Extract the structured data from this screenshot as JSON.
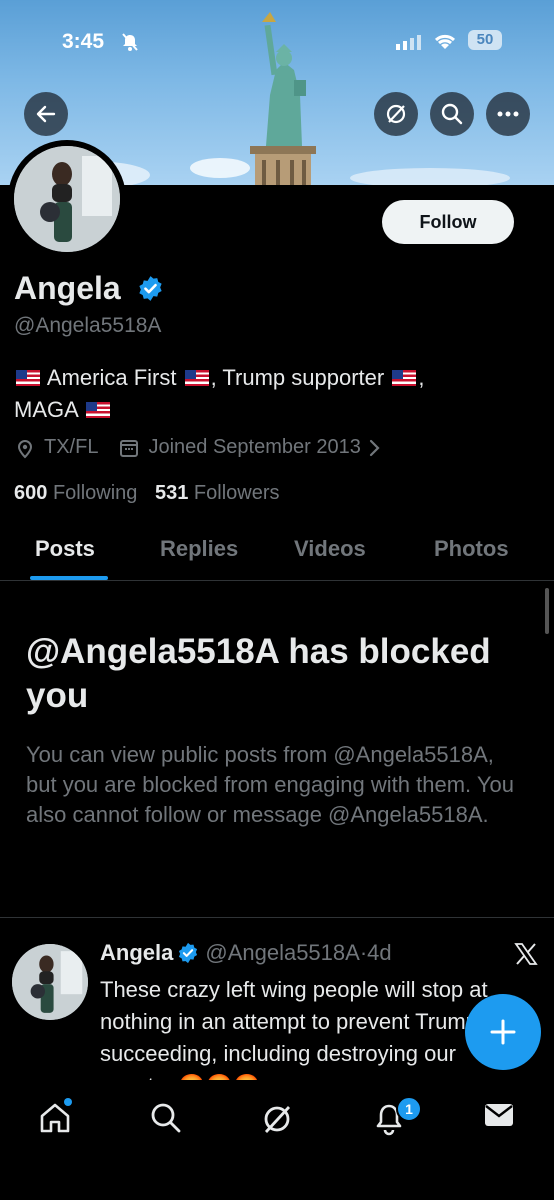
{
  "status_bar": {
    "time": "3:45",
    "battery": "50"
  },
  "profile": {
    "name": "Angela",
    "handle": "@Angela5518A",
    "bio_line1_a": "America First",
    "bio_line1_b": ", Trump supporter",
    "bio_line1_c": ",",
    "bio_line2": "MAGA",
    "location": "TX/FL",
    "joined": "Joined September 2013",
    "following_count": "600",
    "following_label": "Following",
    "followers_count": "531",
    "followers_label": "Followers",
    "follow_button": "Follow"
  },
  "tabs": [
    {
      "label": "Posts",
      "active": true
    },
    {
      "label": "Replies",
      "active": false
    },
    {
      "label": "Videos",
      "active": false
    },
    {
      "label": "Photos",
      "active": false
    }
  ],
  "blocked_notice": {
    "title": "@Angela5518A has blocked you",
    "body": "You can view public posts from @Angela5518A, but you are blocked from engaging with them. You also cannot follow or message @Angela5518A."
  },
  "post": {
    "author": "Angela",
    "handle": "@Angela5518A",
    "separator": "·",
    "age": "4d",
    "text": "These crazy left wing people will stop at nothing in an attempt to prevent Trump from succeeding, including destroying our country 😡😡😡"
  },
  "bottom_nav": {
    "notifications_badge": "1"
  },
  "icons": [
    "back-arrow-icon",
    "grok-icon",
    "search-icon",
    "more-icon",
    "verified-badge-icon",
    "location-icon",
    "calendar-icon",
    "chevron-right-icon",
    "x-logo-icon",
    "plus-icon",
    "home-icon",
    "bell-icon",
    "mail-icon"
  ],
  "colors": {
    "accent": "#1d9bf0",
    "background": "#000000",
    "muted": "#71767b"
  }
}
